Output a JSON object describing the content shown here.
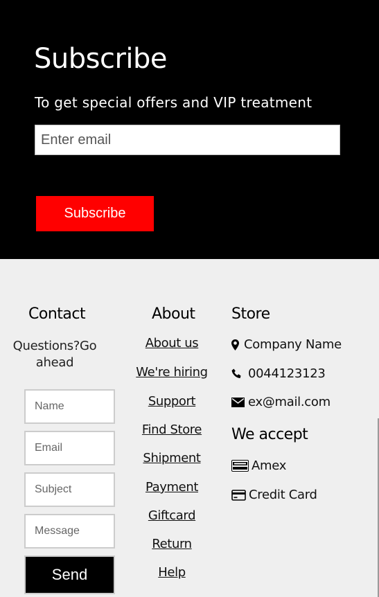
{
  "subscribe": {
    "title": "Subscribe",
    "subtitle": "To get special offers and VIP treatment",
    "email_placeholder": "Enter email",
    "button_label": "Subscribe",
    "button_color": "#ff0000"
  },
  "contact": {
    "heading": "Contact",
    "text": "Questions?Go ahead",
    "name_placeholder": "Name",
    "email_placeholder": "Email",
    "subject_placeholder": "Subject",
    "message_placeholder": "Message",
    "send_label": "Send"
  },
  "about": {
    "heading": "About",
    "links": [
      "About us",
      "We're hiring",
      "Support",
      "Find Store",
      "Shipment",
      "Payment",
      "Giftcard",
      "Return",
      "Help"
    ]
  },
  "store": {
    "heading": "Store",
    "company": "Company Name",
    "phone": "0044123123",
    "email": "ex@mail.com",
    "accept_heading": "We accept",
    "amex": "Amex",
    "credit_card": "Credit Card",
    "icons": [
      "map-marker-icon",
      "phone-icon",
      "envelope-icon",
      "amex-card-icon",
      "credit-card-icon"
    ]
  }
}
